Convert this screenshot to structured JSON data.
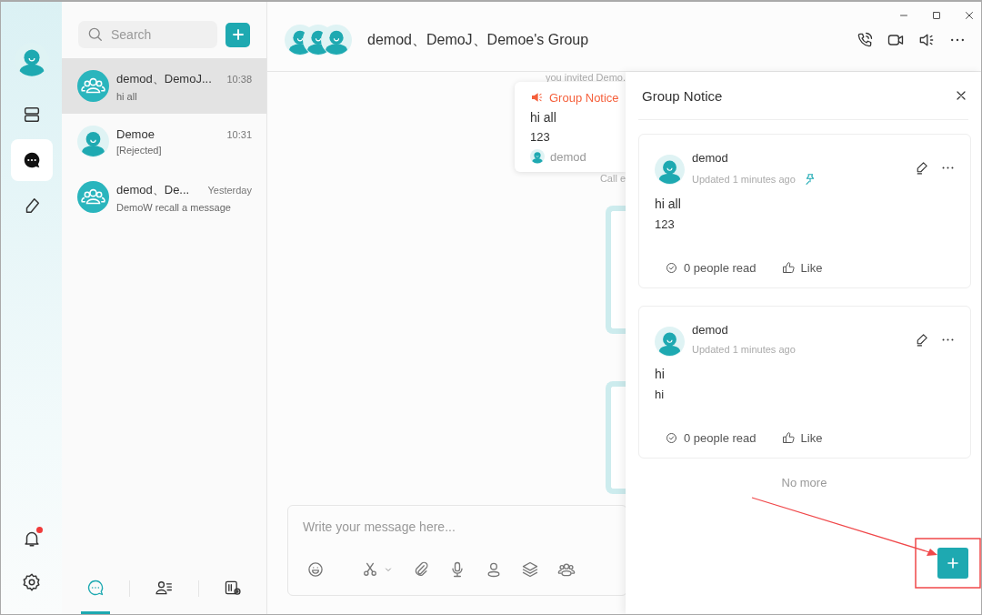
{
  "rail": {
    "items": [
      {
        "kind": "panels",
        "selected": false
      },
      {
        "kind": "chat",
        "selected": true
      },
      {
        "kind": "pen",
        "selected": false
      }
    ],
    "bell": {
      "unread": true
    }
  },
  "search": {
    "placeholder": "Search"
  },
  "conversations": [
    {
      "kind": "group",
      "name": "demod、DemoJ...",
      "time": "10:38",
      "preview": "hi all",
      "selected": true
    },
    {
      "kind": "person",
      "name": "Demoe",
      "time": "10:31",
      "preview": "[Rejected]",
      "selected": false
    },
    {
      "kind": "group",
      "name": "demod、De...",
      "time": "Yesterday",
      "preview": "DemoW recall a message",
      "selected": false
    }
  ],
  "bottom_tabs": [
    {
      "kind": "chats",
      "selected": true
    },
    {
      "kind": "contacts",
      "selected": false
    },
    {
      "kind": "workspace",
      "selected": false
    }
  ],
  "chat": {
    "title": "demod、DemoJ、Demoe's Group",
    "system_notes": [
      "you invited Demo.",
      "Call e"
    ],
    "notice_popup": {
      "title": "Group Notice",
      "lines": [
        "hi all",
        "123"
      ],
      "author": "demod"
    },
    "composer": {
      "placeholder": "Write your message here..."
    }
  },
  "notice_panel": {
    "title": "Group Notice",
    "notices": [
      {
        "author": "demod",
        "updated": "Updated 1 minutes ago",
        "pinned": true,
        "lines": [
          "hi all",
          "123"
        ],
        "read": "0 people read",
        "like": "Like"
      },
      {
        "author": "demod",
        "updated": "Updated 1 minutes ago",
        "pinned": false,
        "lines": [
          "hi",
          "hi"
        ],
        "read": "0 people read",
        "like": "Like"
      }
    ],
    "footer": "No more"
  }
}
